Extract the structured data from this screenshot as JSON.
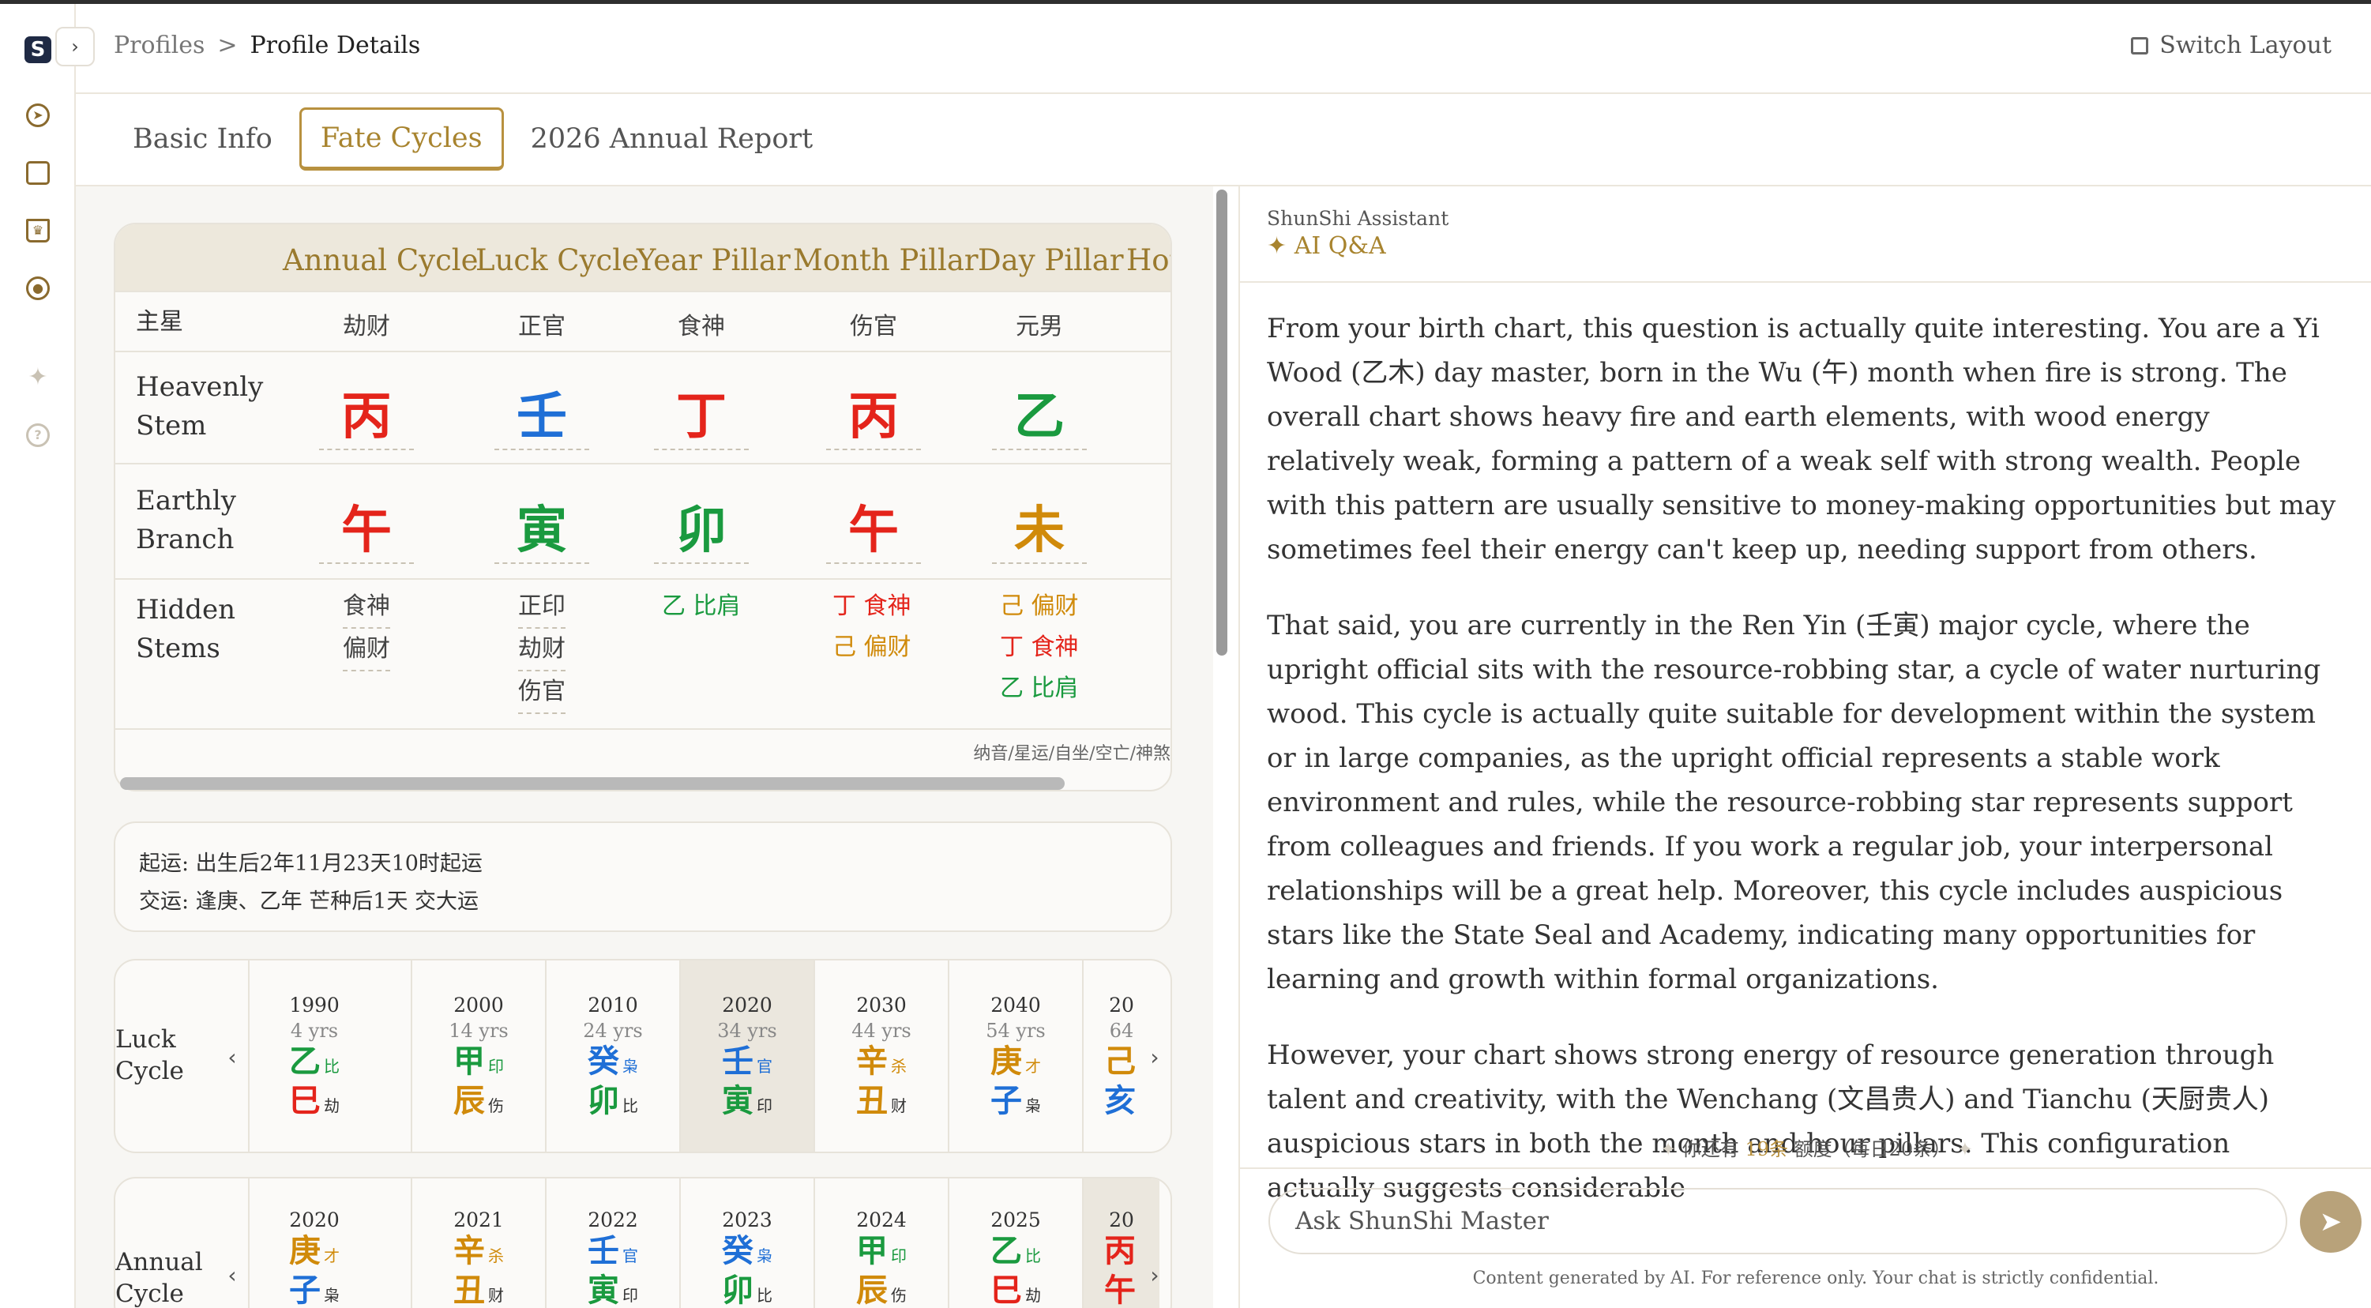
{
  "header": {
    "breadcrumb_root": "Profiles",
    "breadcrumb_sep": ">",
    "breadcrumb_current": "Profile Details",
    "switch_layout": "Switch Layout"
  },
  "tabs": [
    "Basic Info",
    "Fate Cycles",
    "2026 Annual Report"
  ],
  "active_tab": "Fate Cycles",
  "pillars": {
    "columns": [
      "Annual Cycle",
      "Luck Cycle",
      "Year Pillar",
      "Month Pillar",
      "Day Pillar",
      "Hou"
    ],
    "rows": {
      "main_star_label": "主星",
      "main_star": [
        "劫财",
        "正官",
        "食神",
        "伤官",
        "元男"
      ],
      "heavenly_label": "Heavenly Stem",
      "heavenly": [
        "丙",
        "壬",
        "丁",
        "丙",
        "乙"
      ],
      "earthly_label": "Earthly Branch",
      "earthly": [
        "午",
        "寅",
        "卯",
        "午",
        "未"
      ],
      "hidden_label": "Hidden Stems",
      "hidden": [
        [
          "食神",
          "偏财"
        ],
        [
          "正印",
          "劫财",
          "伤官"
        ],
        [
          "乙 比肩"
        ],
        [
          "丁 食神",
          "己 偏财"
        ],
        [
          "己 偏财",
          "丁 食神",
          "乙 比肩"
        ]
      ]
    },
    "footer": "纳音/星运/自坐/空亡/神煞"
  },
  "colors": {
    "fire": "#e4241b",
    "water": "#1f6fd6",
    "wood": "#1a9a3f",
    "earth": "#d08a0a",
    "accent": "#b8913f"
  },
  "start_info": {
    "line1": "起运: 出生后2年11月23天10时起运",
    "line2": "交运: 逢庚、乙年 芒种后1天 交大运"
  },
  "luck_cycle": {
    "label": "Luck Cycle",
    "columns": [
      {
        "year": "1990",
        "age": "4 yrs",
        "stem": "乙",
        "stem_tag": "比",
        "branch": "巳",
        "branch_tag": "劫"
      },
      {
        "year": "2000",
        "age": "14 yrs",
        "stem": "甲",
        "stem_tag": "印",
        "branch": "辰",
        "branch_tag": "伤"
      },
      {
        "year": "2010",
        "age": "24 yrs",
        "stem": "癸",
        "stem_tag": "枭",
        "branch": "卯",
        "branch_tag": "比"
      },
      {
        "year": "2020",
        "age": "34 yrs",
        "stem": "壬",
        "stem_tag": "官",
        "branch": "寅",
        "branch_tag": "印"
      },
      {
        "year": "2030",
        "age": "44 yrs",
        "stem": "辛",
        "stem_tag": "杀",
        "branch": "丑",
        "branch_tag": "财"
      },
      {
        "year": "2040",
        "age": "54 yrs",
        "stem": "庚",
        "stem_tag": "才",
        "branch": "子",
        "branch_tag": "枭"
      },
      {
        "year": "20",
        "age": "64",
        "stem": "己",
        "stem_tag": "",
        "branch": "亥",
        "branch_tag": ""
      }
    ]
  },
  "annual_cycle": {
    "label": "Annual Cycle",
    "columns": [
      {
        "year": "2020",
        "stem": "庚",
        "stem_tag": "才",
        "branch": "子",
        "branch_tag": "枭"
      },
      {
        "year": "2021",
        "stem": "辛",
        "stem_tag": "杀",
        "branch": "丑",
        "branch_tag": "财"
      },
      {
        "year": "2022",
        "stem": "壬",
        "stem_tag": "官",
        "branch": "寅",
        "branch_tag": "印"
      },
      {
        "year": "2023",
        "stem": "癸",
        "stem_tag": "枭",
        "branch": "卯",
        "branch_tag": "比"
      },
      {
        "year": "2024",
        "stem": "甲",
        "stem_tag": "印",
        "branch": "辰",
        "branch_tag": "伤"
      },
      {
        "year": "2025",
        "stem": "乙",
        "stem_tag": "比",
        "branch": "巳",
        "branch_tag": "劫"
      },
      {
        "year": "20",
        "stem": "丙",
        "stem_tag": "",
        "branch": "午",
        "branch_tag": ""
      }
    ]
  },
  "assistant": {
    "name": "ShunShi Assistant",
    "mode": "AI Q&A",
    "paragraph1": "From your birth chart, this question is actually quite interesting. You are a Yi Wood (乙木) day master, born in the Wu (午) month when fire is strong. The overall chart shows heavy fire and earth elements, with wood energy relatively weak, forming a pattern of a weak self with strong wealth. People with this pattern are usually sensitive to money-making opportunities but may sometimes feel their energy can't keep up, needing support from others.",
    "paragraph2": "That said, you are currently in the Ren Yin (壬寅) major cycle, where the upright official sits with the resource-robbing star, a cycle of water nurturing wood. This cycle is actually quite suitable for development within the system or in large companies, as the upright official represents a stable work environment and rules, while the resource-robbing star represents support from colleagues and friends. If you work a regular job, your interpersonal relationships will be a great help. Moreover, this cycle includes auspicious stars like the State Seal and Academy, indicating many opportunities for learning and growth within formal organizations.",
    "paragraph3": "However, your chart shows strong energy of resource generation through talent and creativity, with the Wenchang (文昌贵人) and Tianchu (天厨贵人) auspicious stars in both the month and hour pillars. This configuration actually suggests considerable",
    "quota_prefix": "你还有",
    "quota_count": "19条",
    "quota_suffix": "额度（每日20条）",
    "input_placeholder": "Ask ShunShi Master",
    "disclaimer": "Content generated by AI. For reference only. Your chat is strictly confidential."
  }
}
